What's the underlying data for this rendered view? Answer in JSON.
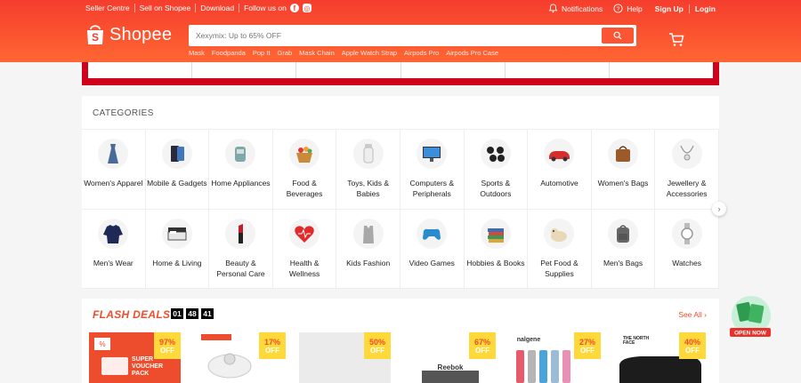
{
  "topbar": {
    "seller_centre": "Seller Centre",
    "sell_on_shopee": "Sell on Shopee",
    "download": "Download",
    "follow_us": "Follow us on",
    "notifications": "Notifications",
    "help": "Help",
    "sign_up": "Sign Up",
    "login": "Login"
  },
  "header": {
    "brand": "Shopee",
    "search_placeholder": "Xexymix: Up to 65% OFF",
    "keywords": [
      "Mask",
      "Foodpanda",
      "Pop It",
      "Grab",
      "Mask Chain",
      "Apple Watch Strap",
      "Airpods Pro",
      "Airpods Pro Case"
    ]
  },
  "categories": {
    "title": "CATEGORIES",
    "items": [
      {
        "label": "Women's Apparel",
        "icon": "dress-icon"
      },
      {
        "label": "Mobile & Gadgets",
        "icon": "phone-icon"
      },
      {
        "label": "Home Appliances",
        "icon": "appliance-icon"
      },
      {
        "label": "Food & Beverages",
        "icon": "food-basket-icon"
      },
      {
        "label": "Toys, Kids & Babies",
        "icon": "baby-bottle-icon"
      },
      {
        "label": "Computers & Peripherals",
        "icon": "monitor-icon"
      },
      {
        "label": "Sports & Outdoors",
        "icon": "dumbbell-icon"
      },
      {
        "label": "Automotive",
        "icon": "car-icon"
      },
      {
        "label": "Women's Bags",
        "icon": "handbag-icon"
      },
      {
        "label": "Jewellery & Accessories",
        "icon": "necklace-icon"
      },
      {
        "label": "Men's Wear",
        "icon": "sweater-icon"
      },
      {
        "label": "Home & Living",
        "icon": "bed-icon"
      },
      {
        "label": "Beauty & Personal Care",
        "icon": "lipstick-icon"
      },
      {
        "label": "Health & Wellness",
        "icon": "heart-icon"
      },
      {
        "label": "Kids Fashion",
        "icon": "kids-outfit-icon"
      },
      {
        "label": "Video Games",
        "icon": "gamepad-icon"
      },
      {
        "label": "Hobbies & Books",
        "icon": "books-icon"
      },
      {
        "label": "Pet Food & Supplies",
        "icon": "dog-icon"
      },
      {
        "label": "Men's Bags",
        "icon": "backpack-icon"
      },
      {
        "label": "Watches",
        "icon": "watch-icon"
      }
    ]
  },
  "flash": {
    "title": "FLASH DEALS",
    "timer": [
      "01",
      "48",
      "41"
    ],
    "see_all": "See All",
    "items": [
      {
        "discount": "97%",
        "off": "OFF"
      },
      {
        "discount": "17%",
        "off": "OFF"
      },
      {
        "discount": "50%",
        "off": "OFF"
      },
      {
        "discount": "67%",
        "off": "OFF"
      },
      {
        "discount": "27%",
        "off": "OFF"
      },
      {
        "discount": "40%",
        "off": "OFF"
      }
    ],
    "voucher_text": "SUPER VOUCHER PACK",
    "brand_reebok": "Reebok",
    "brand_nalgene": "nalgene",
    "brand_tnf": "THE NORTH FACE"
  },
  "open_app": "OPEN NOW",
  "colors": {
    "brand": "#ee4d2d",
    "badge": "#ffd839"
  }
}
